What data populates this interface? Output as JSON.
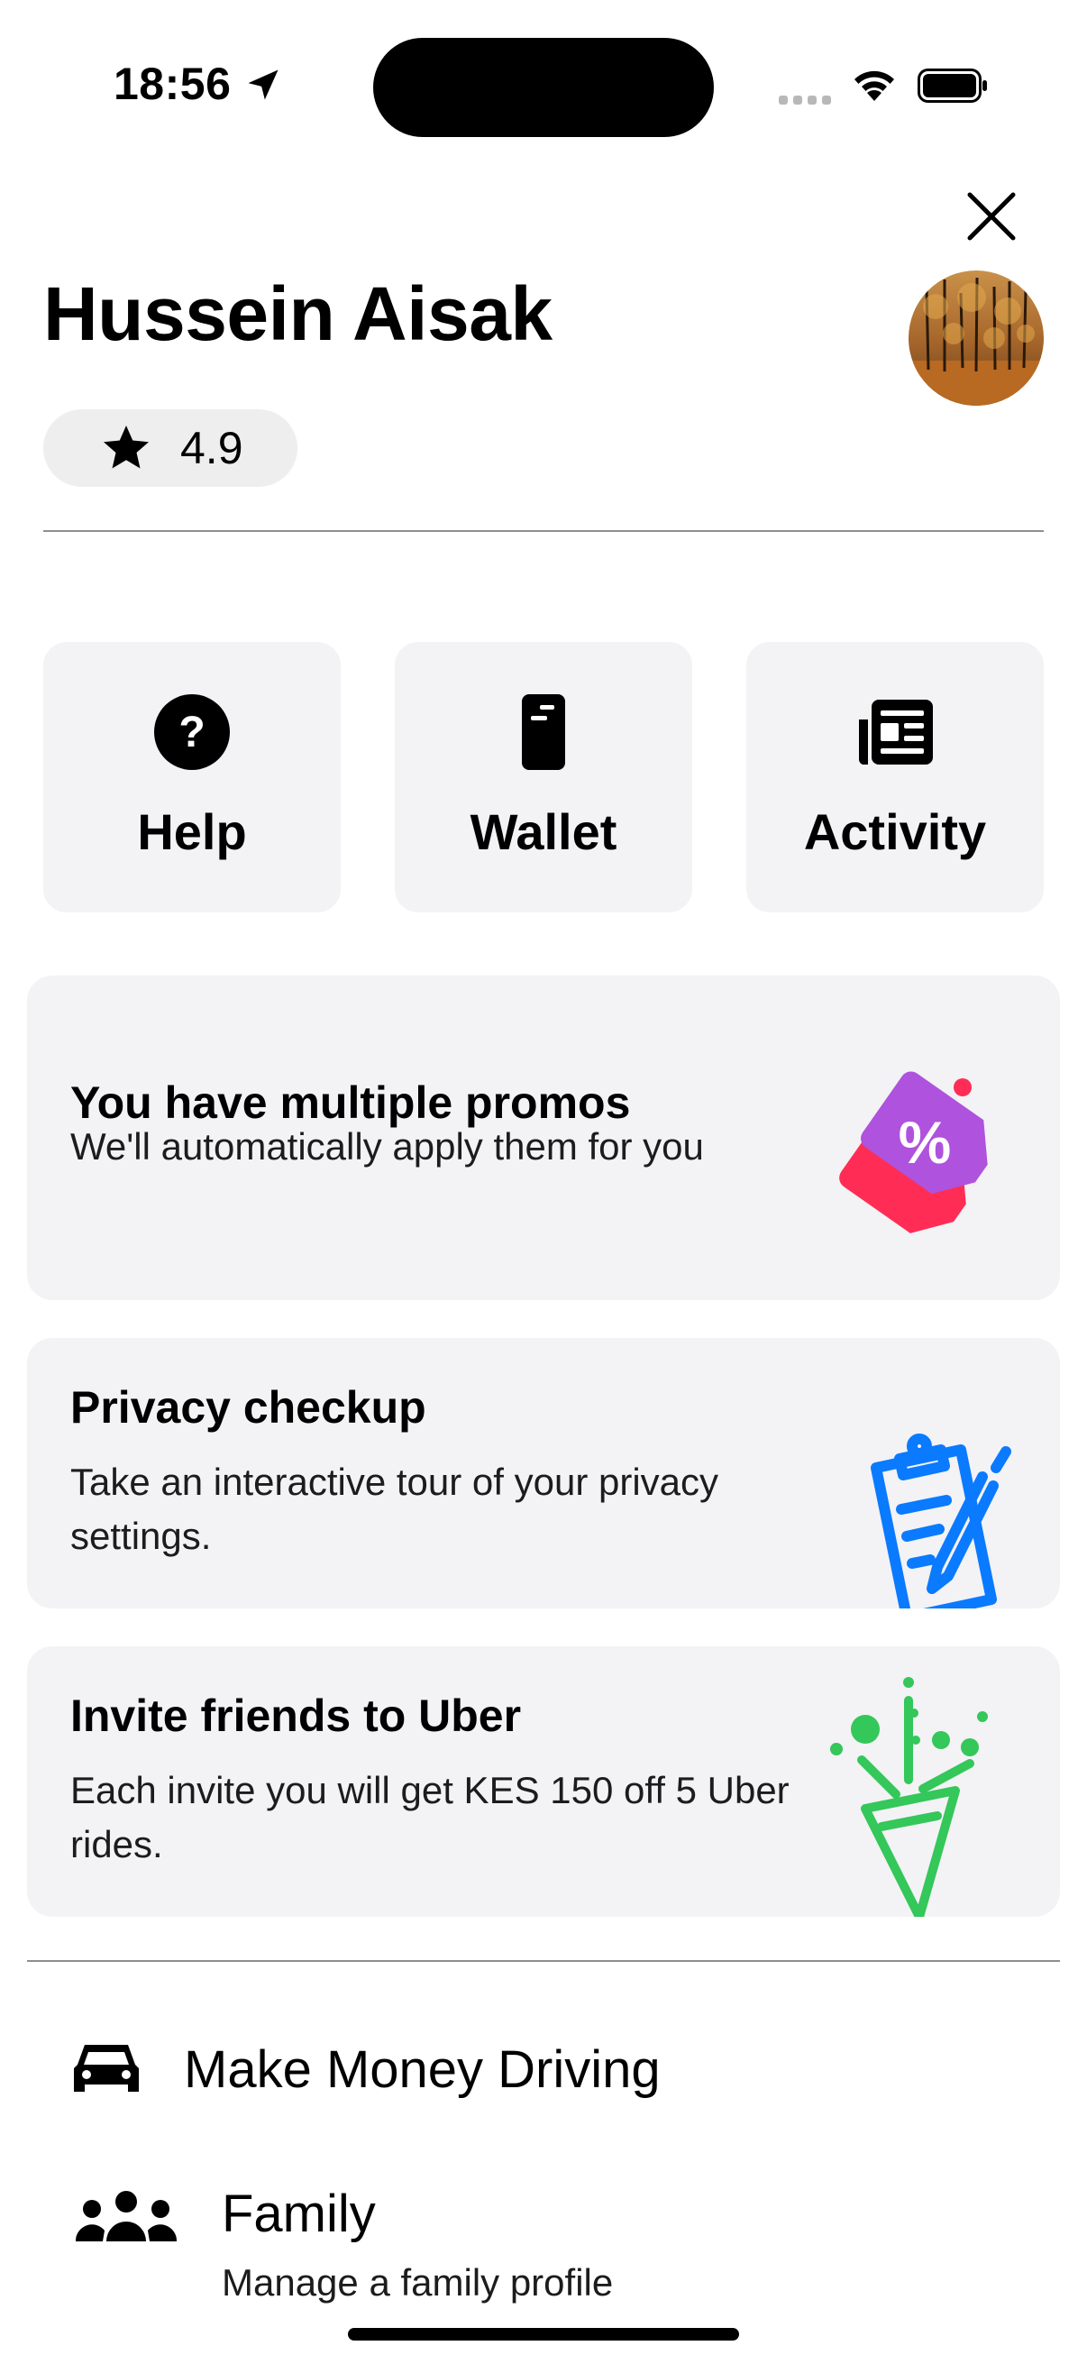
{
  "status_bar": {
    "time": "18:56"
  },
  "header": {
    "name": "Hussein Aisak",
    "rating": "4.9"
  },
  "tiles": [
    {
      "label": "Help",
      "icon": "help-icon"
    },
    {
      "label": "Wallet",
      "icon": "wallet-icon"
    },
    {
      "label": "Activity",
      "icon": "activity-icon"
    }
  ],
  "cards": {
    "promo": {
      "title": "You have multiple promos",
      "description": "We'll automatically apply them for you"
    },
    "privacy": {
      "title": "Privacy checkup",
      "description": "Take an interactive tour of your privacy settings."
    },
    "invite": {
      "title": "Invite friends to Uber",
      "description": "Each invite you will get KES 150 off 5 Uber rides."
    }
  },
  "menu": [
    {
      "label": "Make Money Driving",
      "icon": "car-icon"
    },
    {
      "label": "Family",
      "sublabel": "Manage a family profile",
      "icon": "family-icon"
    }
  ],
  "colors": {
    "tile_bg": "#f3f2f5",
    "promo_purple": "#af52de",
    "promo_red": "#ff2d55",
    "privacy_blue": "#0a7aff",
    "invite_green": "#34c759"
  }
}
